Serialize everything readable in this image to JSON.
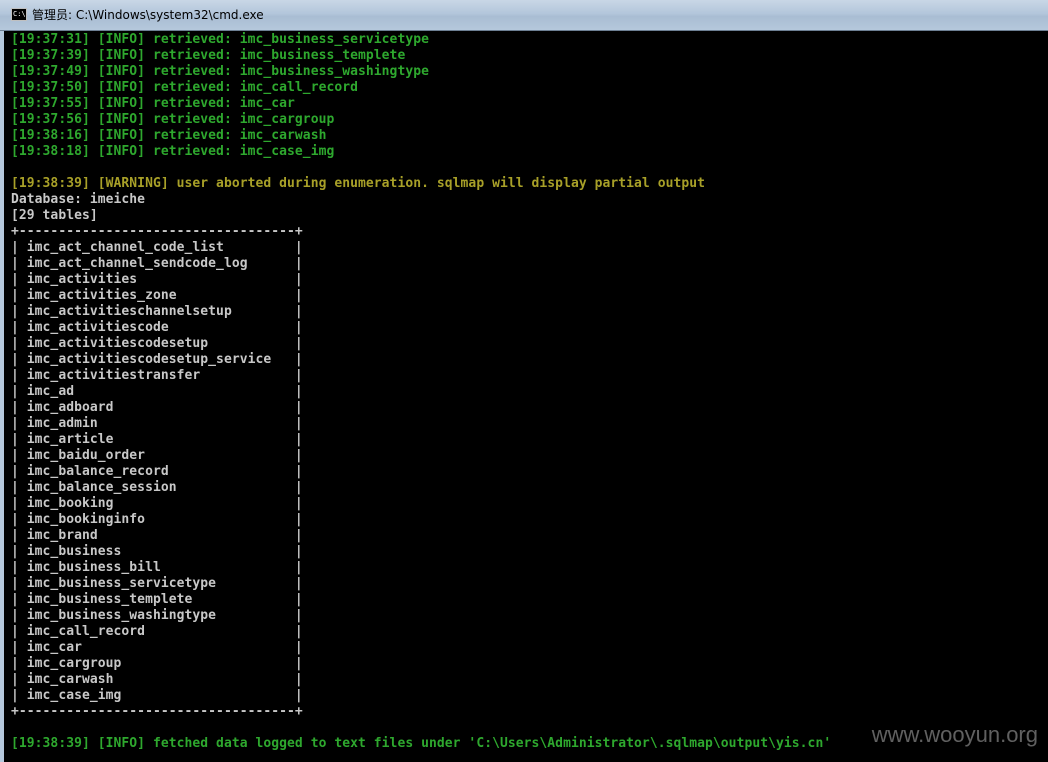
{
  "window": {
    "title": "管理员: C:\\Windows\\system32\\cmd.exe",
    "icon": "C:\\"
  },
  "colors": {
    "info": "#2ea82e",
    "warning": "#a8a028",
    "default": "#c8c8c8"
  },
  "console": {
    "lines": [
      {
        "text": "[19:37:31] [INFO] retrieved: imc_business_servicetype",
        "level": "info"
      },
      {
        "text": "[19:37:39] [INFO] retrieved: imc_business_templete",
        "level": "info"
      },
      {
        "text": "[19:37:49] [INFO] retrieved: imc_business_washingtype",
        "level": "info"
      },
      {
        "text": "[19:37:50] [INFO] retrieved: imc_call_record",
        "level": "info"
      },
      {
        "text": "[19:37:55] [INFO] retrieved: imc_car",
        "level": "info"
      },
      {
        "text": "[19:37:56] [INFO] retrieved: imc_cargroup",
        "level": "info"
      },
      {
        "text": "[19:38:16] [INFO] retrieved: imc_carwash",
        "level": "info"
      },
      {
        "text": "[19:38:18] [INFO] retrieved: imc_case_img",
        "level": "info"
      },
      {
        "text": "",
        "level": "blank"
      },
      {
        "text": "[19:38:39] [WARNING] user aborted during enumeration. sqlmap will display partial output",
        "level": "warning"
      },
      {
        "text": "Database: imeiche",
        "level": "default"
      },
      {
        "text": "[29 tables]",
        "level": "default"
      },
      {
        "text": "+-----------------------------------+",
        "level": "default"
      },
      {
        "text": "| imc_act_channel_code_list         |",
        "level": "default"
      },
      {
        "text": "| imc_act_channel_sendcode_log      |",
        "level": "default"
      },
      {
        "text": "| imc_activities                    |",
        "level": "default"
      },
      {
        "text": "| imc_activities_zone               |",
        "level": "default"
      },
      {
        "text": "| imc_activitieschannelsetup        |",
        "level": "default"
      },
      {
        "text": "| imc_activitiescode                |",
        "level": "default"
      },
      {
        "text": "| imc_activitiescodesetup           |",
        "level": "default"
      },
      {
        "text": "| imc_activitiescodesetup_service   |",
        "level": "default"
      },
      {
        "text": "| imc_activitiestransfer            |",
        "level": "default"
      },
      {
        "text": "| imc_ad                            |",
        "level": "default"
      },
      {
        "text": "| imc_adboard                       |",
        "level": "default"
      },
      {
        "text": "| imc_admin                         |",
        "level": "default"
      },
      {
        "text": "| imc_article                       |",
        "level": "default"
      },
      {
        "text": "| imc_baidu_order                   |",
        "level": "default"
      },
      {
        "text": "| imc_balance_record                |",
        "level": "default"
      },
      {
        "text": "| imc_balance_session               |",
        "level": "default"
      },
      {
        "text": "| imc_booking                       |",
        "level": "default"
      },
      {
        "text": "| imc_bookinginfo                   |",
        "level": "default"
      },
      {
        "text": "| imc_brand                         |",
        "level": "default"
      },
      {
        "text": "| imc_business                      |",
        "level": "default"
      },
      {
        "text": "| imc_business_bill                 |",
        "level": "default"
      },
      {
        "text": "| imc_business_servicetype          |",
        "level": "default"
      },
      {
        "text": "| imc_business_templete             |",
        "level": "default"
      },
      {
        "text": "| imc_business_washingtype          |",
        "level": "default"
      },
      {
        "text": "| imc_call_record                   |",
        "level": "default"
      },
      {
        "text": "| imc_car                           |",
        "level": "default"
      },
      {
        "text": "| imc_cargroup                      |",
        "level": "default"
      },
      {
        "text": "| imc_carwash                       |",
        "level": "default"
      },
      {
        "text": "| imc_case_img                      |",
        "level": "default"
      },
      {
        "text": "+-----------------------------------+",
        "level": "default"
      },
      {
        "text": "",
        "level": "blank"
      },
      {
        "text": "[19:38:39] [INFO] fetched data logged to text files under 'C:\\Users\\Administrator\\.sqlmap\\output\\yis.cn'",
        "level": "info"
      }
    ]
  },
  "watermark": "www.wooyun.org"
}
